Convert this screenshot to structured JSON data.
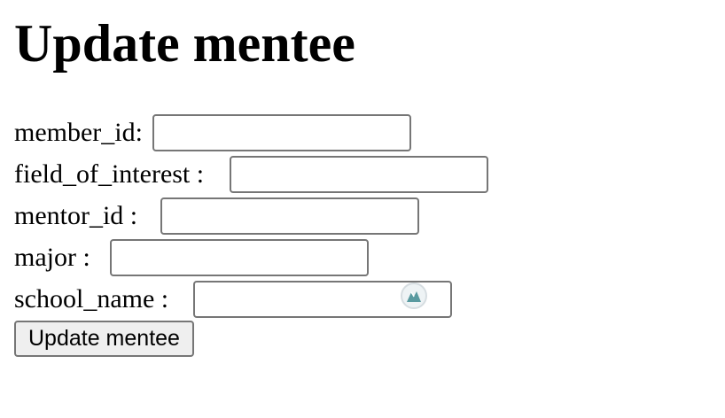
{
  "page": {
    "title": "Update mentee"
  },
  "form": {
    "fields": [
      {
        "label": "member_id:",
        "value": ""
      },
      {
        "label": "field_of_interest :",
        "value": ""
      },
      {
        "label": "mentor_id :",
        "value": ""
      },
      {
        "label": "major :",
        "value": ""
      },
      {
        "label": "school_name :",
        "value": ""
      }
    ],
    "submit_label": "Update mentee"
  },
  "icons": {
    "autofill": "password-manager-icon"
  },
  "colors": {
    "autofill_icon": "#5a9aa0"
  }
}
